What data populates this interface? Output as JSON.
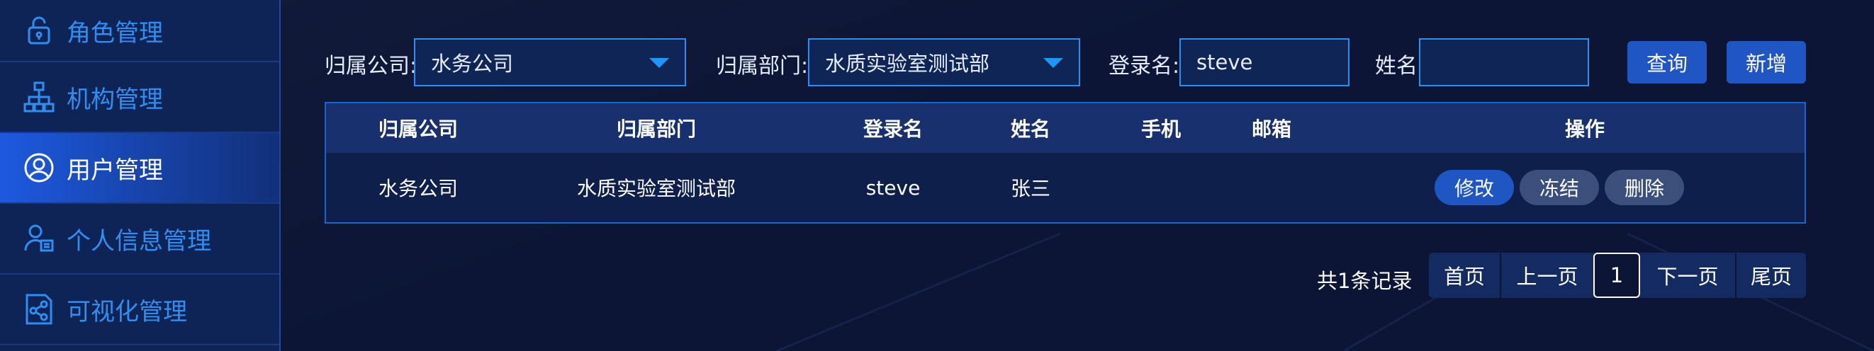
{
  "sidebar": {
    "items": [
      {
        "label": "角色管理",
        "icon": "lock-icon",
        "active": false
      },
      {
        "label": "机构管理",
        "icon": "org-tree-icon",
        "active": false
      },
      {
        "label": "用户管理",
        "icon": "user-circle-icon",
        "active": true
      },
      {
        "label": "个人信息管理",
        "icon": "user-card-icon",
        "active": false
      },
      {
        "label": "可视化管理",
        "icon": "share-icon",
        "active": false
      }
    ]
  },
  "filters": {
    "company_label": "归属公司:",
    "company_value": "水务公司",
    "dept_label": "归属部门:",
    "dept_value": "水质实验室测试部",
    "login_label": "登录名:",
    "login_value": "steve",
    "name_label": "姓名:",
    "name_value": "",
    "query_button": "查询",
    "add_button": "新增"
  },
  "table": {
    "headers": [
      "归属公司",
      "归属部门",
      "登录名",
      "姓名",
      "手机",
      "邮箱",
      "操作"
    ],
    "rows": [
      {
        "company": "水务公司",
        "dept": "水质实验室测试部",
        "login": "steve",
        "name": "张三",
        "phone": "",
        "email": "",
        "actions": [
          "修改",
          "冻结",
          "删除"
        ]
      }
    ]
  },
  "pagination": {
    "total": "共1条记录",
    "first": "首页",
    "prev": "上一页",
    "current": "1",
    "next": "下一页",
    "last": "尾页"
  },
  "colors": {
    "accent": "#2f8ff0",
    "primary_button": "#1f56c4",
    "secondary_button": "#3b4f7c",
    "background": "#0c1535"
  }
}
